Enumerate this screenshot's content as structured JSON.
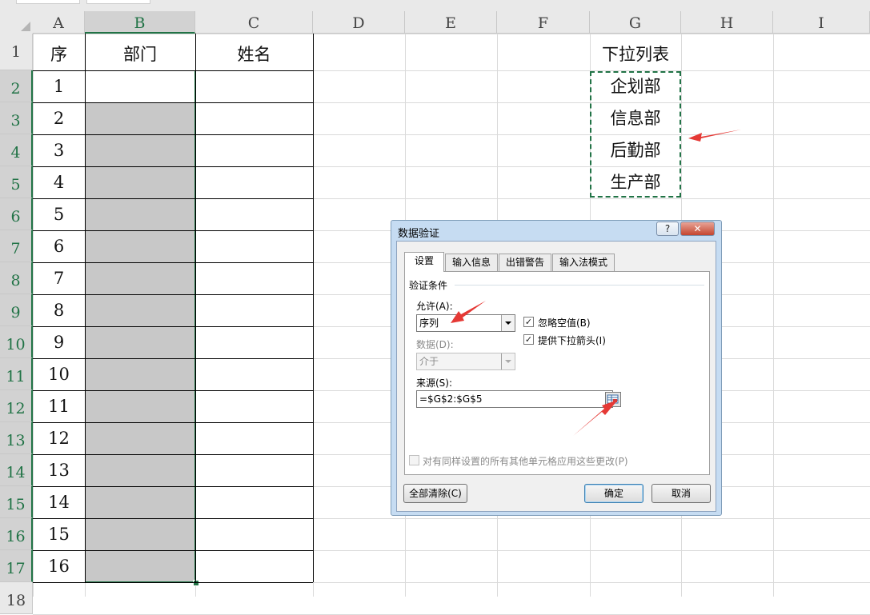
{
  "spreadsheet": {
    "columns": [
      "A",
      "B",
      "C",
      "D",
      "E",
      "F",
      "G",
      "H",
      "I"
    ],
    "rows": [
      "1",
      "2",
      "3",
      "4",
      "5",
      "6",
      "7",
      "8",
      "9",
      "10",
      "11",
      "12",
      "13",
      "14",
      "15",
      "16",
      "17",
      "18"
    ],
    "headers": {
      "seq": "序",
      "dept": "部门",
      "name": "姓名"
    },
    "seq_values": [
      "1",
      "2",
      "3",
      "4",
      "5",
      "6",
      "7",
      "8",
      "9",
      "10",
      "11",
      "12",
      "13",
      "14",
      "15",
      "16"
    ],
    "list_title": "下拉列表",
    "list_items": [
      "企划部",
      "信息部",
      "后勤部",
      "生产部"
    ]
  },
  "dialog": {
    "title": "数据验证",
    "help_glyph": "?",
    "close_glyph": "✕",
    "tabs": [
      "设置",
      "输入信息",
      "出错警告",
      "输入法模式"
    ],
    "section_title": "验证条件",
    "allow_label": "允许(A):",
    "allow_value": "序列",
    "ignore_blank_label": "忽略空值(B)",
    "dropdown_label": "提供下拉箭头(I)",
    "data_label": "数据(D):",
    "data_value": "介于",
    "source_label": "来源(S):",
    "source_value": "=$G$2:$G$5",
    "apply_all_label": "对有同样设置的所有其他单元格应用这些更改(P)",
    "clear_all_label": "全部清除(C)",
    "ok_label": "确定",
    "cancel_label": "取消",
    "check_mark": "✓"
  },
  "colors": {
    "accent": "#217346",
    "annotation_arrow": "#e53935",
    "selection_fill": "#c8c8c8"
  }
}
